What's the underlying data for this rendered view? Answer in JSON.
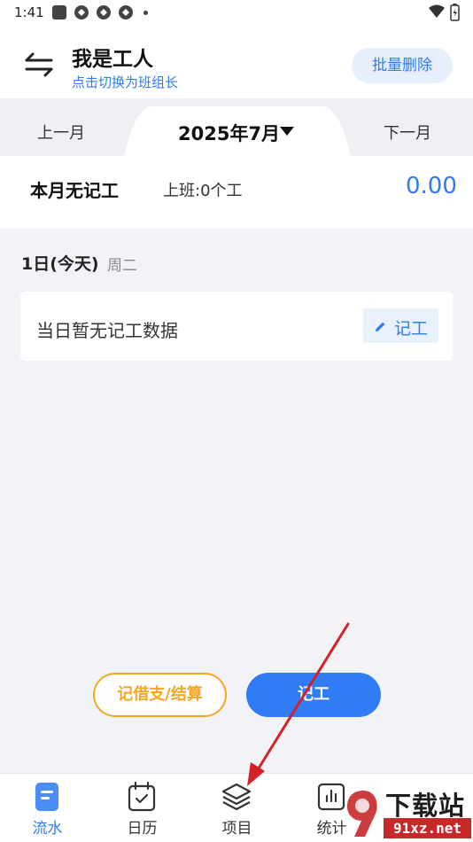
{
  "status_bar": {
    "time": "1:41"
  },
  "header": {
    "role_title": "我是工人",
    "role_switch_hint": "点击切换为班组长",
    "batch_delete_label": "批量删除"
  },
  "month_nav": {
    "prev_label": "上一月",
    "current_label": "2025年7月",
    "next_label": "下一月"
  },
  "summary": {
    "title": "本月无记工",
    "work_text": "上班:0个工",
    "amount": "0.00"
  },
  "day": {
    "date_label": "1日(今天)",
    "weekday": "周二",
    "empty_text": "当日暂无记工数据",
    "record_label": "记工"
  },
  "actions": {
    "borrow_settle_label": "记借支/结算",
    "record_work_label": "记工"
  },
  "tabbar": {
    "items": [
      {
        "label": "流水",
        "icon": "document-icon",
        "active": true
      },
      {
        "label": "日历",
        "icon": "calendar-icon",
        "active": false
      },
      {
        "label": "项目",
        "icon": "layers-icon",
        "active": false
      },
      {
        "label": "统计",
        "icon": "chart-icon",
        "active": false
      }
    ]
  },
  "watermark": {
    "title": "下载站",
    "url": "91xz.net"
  },
  "colors": {
    "accent": "#2f7cf6",
    "orange": "#f5a623",
    "annotation_arrow": "#d42027"
  }
}
